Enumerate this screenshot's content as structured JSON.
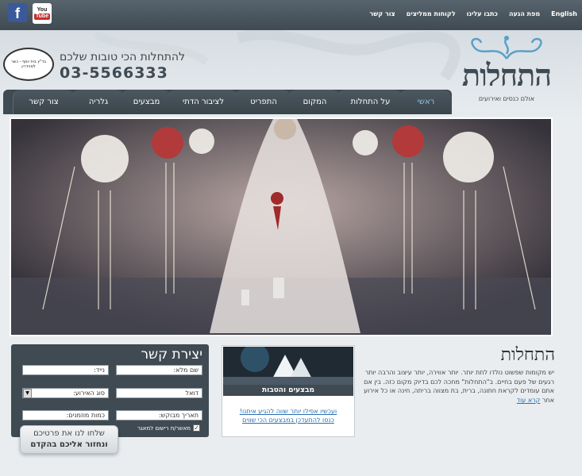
{
  "topnav": {
    "links": [
      "English",
      "מפת הגעה",
      "כתבו עלינו",
      "לקוחות ממליצים",
      "צור קשר"
    ]
  },
  "social": {
    "facebook_glyph": "f",
    "youtube_you": "You",
    "youtube_tube": "Tube"
  },
  "brand": {
    "logo_text": "התחלות",
    "logo_sub": "אולם כנסים ואירועים"
  },
  "header": {
    "tagline": "להתחלות הכי טובות שלכם",
    "phone": "03-5566333",
    "kosher_text": "בד\"ץ בית יוסף - כשר למהדרין"
  },
  "nav": {
    "tabs": [
      "ראשי",
      "על התחלות",
      "המקום",
      "התפריט",
      "לציבור הדתי",
      "מבצעים",
      "גלריה",
      "צור קשר"
    ],
    "active": "ראשי"
  },
  "about": {
    "title": "התחלות",
    "text": "יש מקומות שפשוט נולדו לתת יותר. יותר אווירה, יותר עיצוב והרבה יותר רגעים של פעם בחיים. ב\"התחלות\" מחכה לכם בדיוק מקום כזה. בין אם אתם עומדים לקראת חתונה, ברית, בת מצווה בריתה, חינה או כל אירוע אחר",
    "read_more": "קרא עוד"
  },
  "promo": {
    "title": "מבצעים והטבות",
    "line1": "ועכשיו אפילו יותר שווה להגיע איתנו!",
    "line2": "כנסו להתעדכן במבצעים הכי שווים"
  },
  "contact": {
    "title": "יצירת קשר",
    "fields": {
      "full_name": "שם מלא:",
      "mobile": "נייד:",
      "email": "דואל",
      "event_type": "סוג האירוע:",
      "date": "תאריך מבוקש:",
      "guests": "כמות מוזמנים:"
    },
    "select_arrow": "▼",
    "consent_label": "מאשר/ת רישום למאגר",
    "checked_mark": "✓",
    "send_line1": "שלחו לנו את פרטיכם",
    "send_line2": "ונחזור אליכם בהקדם"
  },
  "colors": {
    "dark": "#3f4a52",
    "link": "#2a6fb2",
    "accent": "#8fc3e6"
  }
}
